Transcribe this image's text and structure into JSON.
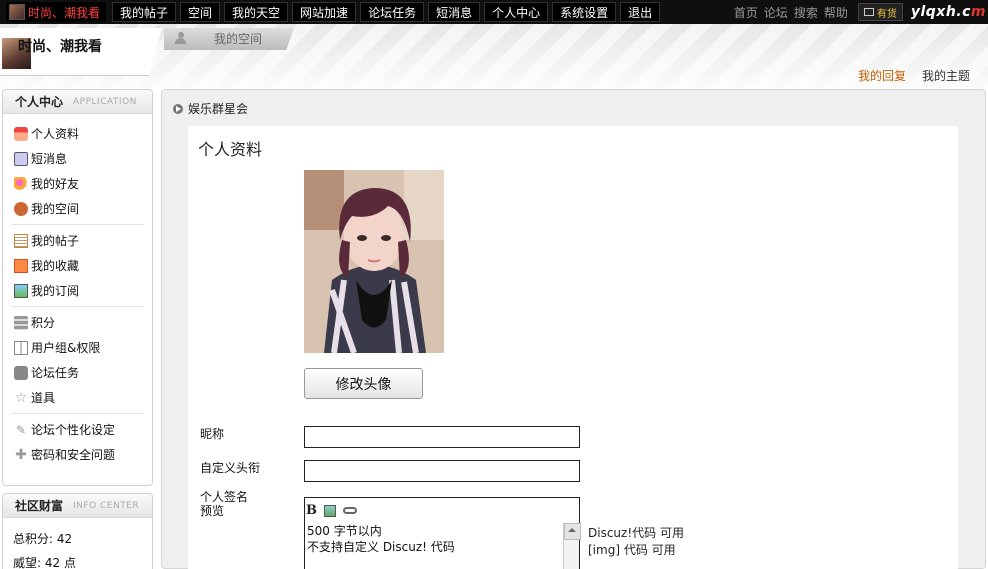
{
  "topbar": {
    "user_name": "时尚、潮我看",
    "menu": [
      "我的帖子",
      "空间",
      "我的天空",
      "网站加速",
      "论坛任务",
      "短消息",
      "个人中心",
      "系统设置",
      "退出"
    ],
    "right_links": [
      "首页",
      "论坛",
      "搜索",
      "帮助"
    ],
    "cart_label": "有货",
    "logo_main": "ylqxh.c",
    "logo_red": "m"
  },
  "header": {
    "site_title": "时尚、潮我看",
    "space_tab": "我的空间",
    "reply_link": "我的回复",
    "topic_link": "我的主题"
  },
  "sidebar": {
    "personal": {
      "title": "个人中心",
      "subtitle": "APPLICATION",
      "groups": [
        [
          {
            "label": "个人资料",
            "icon": "profile-icon"
          },
          {
            "label": "短消息",
            "icon": "message-icon"
          },
          {
            "label": "我的好友",
            "icon": "friends-icon"
          },
          {
            "label": "我的空间",
            "icon": "space-icon"
          }
        ],
        [
          {
            "label": "我的帖子",
            "icon": "posts-icon"
          },
          {
            "label": "我的收藏",
            "icon": "favorites-icon"
          },
          {
            "label": "我的订阅",
            "icon": "subscriptions-icon"
          }
        ],
        [
          {
            "label": "积分",
            "icon": "points-icon"
          },
          {
            "label": "用户组&权限",
            "icon": "book-icon"
          },
          {
            "label": "论坛任务",
            "icon": "tasks-icon"
          },
          {
            "label": "道具",
            "icon": "star-icon"
          }
        ],
        [
          {
            "label": "论坛个性化设定",
            "icon": "wrench-icon"
          },
          {
            "label": "密码和安全问题",
            "icon": "plus-icon"
          }
        ]
      ]
    },
    "wealth": {
      "title": "社区财富",
      "subtitle": "INFO CENTER",
      "rows": [
        "总积分: 42",
        "威望: 42 点"
      ]
    }
  },
  "main": {
    "breadcrumb": "娱乐群星会",
    "section_title": "个人资料",
    "change_avatar_button": "修改头像",
    "fields": {
      "nickname_label": "昵称",
      "nickname_value": "",
      "custom_title_label": "自定义头衔",
      "custom_title_value": "",
      "signature_label_1": "个人签名",
      "signature_label_2": "预览"
    },
    "editor": {
      "bold_label": "B",
      "line1": "500 字节以内",
      "line2": "不支持自定义  Discuz! 代码"
    },
    "notes": [
      "Discuz!代码  可用",
      "[img] 代码  可用"
    ]
  }
}
